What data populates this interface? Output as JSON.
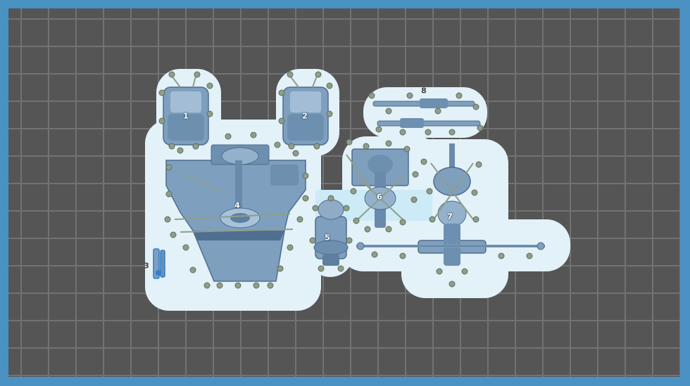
{
  "scene": {
    "title": "",
    "colors": {
      "frame": "#4a92c4",
      "plate": "#555555",
      "grid": "#727272",
      "halo": "#e3f1f8",
      "part": "#7f9fbe",
      "part_dark": "#5f7f9f",
      "support": "#8e9e8b"
    }
  },
  "parts": [
    {
      "id": "part-1",
      "label": "1"
    },
    {
      "id": "part-2",
      "label": "2"
    },
    {
      "id": "part-3",
      "label": "3"
    },
    {
      "id": "part-4",
      "label": "4"
    },
    {
      "id": "part-5",
      "label": "5"
    },
    {
      "id": "part-6",
      "label": "6"
    },
    {
      "id": "part-7",
      "label": "7"
    },
    {
      "id": "part-8",
      "label": "8"
    }
  ]
}
